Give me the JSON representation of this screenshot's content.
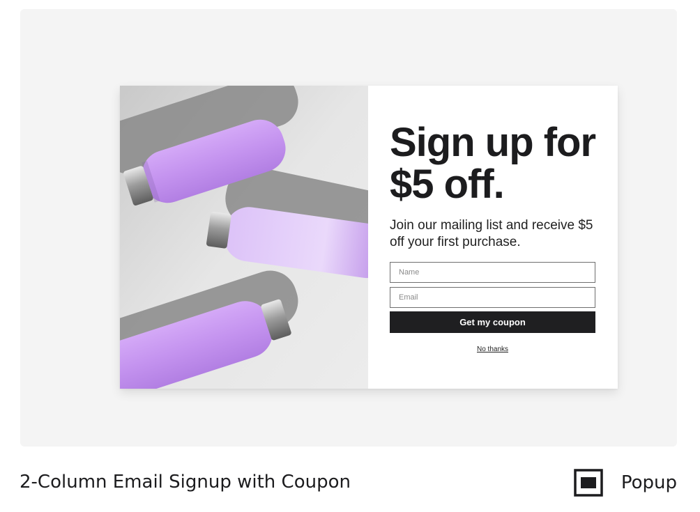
{
  "popup": {
    "headline": "Sign up for $5 off.",
    "subtext": "Join our mailing list and receive $5 off your first purchase.",
    "name_placeholder": "Name",
    "email_placeholder": "Email",
    "cta_label": "Get my coupon",
    "dismiss_label": "No thanks",
    "image_icon": "purple-water-bottles-photo"
  },
  "template": {
    "title": "2-Column Email Signup with Coupon",
    "type_label": "Popup",
    "type_icon": "popup-window-icon"
  },
  "colors": {
    "background_card": "#f4f4f4",
    "button": "#1f1f21",
    "bottle_purple": "#c89ef2"
  }
}
